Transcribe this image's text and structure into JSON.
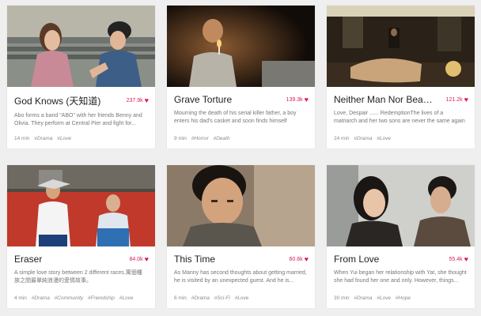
{
  "accent": "#d81b60",
  "cards": [
    {
      "title": "God Knows (天知道)",
      "likes": "237.9k",
      "description": "Abo forms a band \"ABO\" with her friends Benny and Olivia. They perform at Central Pier and fight for...",
      "duration": "14 min",
      "tags": [
        "#Drama",
        "#Love"
      ],
      "heart_icon": "heart-icon"
    },
    {
      "title": "Grave Torture",
      "likes": "139.3k",
      "description": "Mourning the death of his serial killer father, a boy enters his dad's casket and soon finds himself buried...",
      "duration": "9 min",
      "tags": [
        "#Horror",
        "#Death"
      ],
      "heart_icon": "heart-icon"
    },
    {
      "title": "Neither Man Nor Beast (...",
      "likes": "121.2k",
      "description": "Love, Despair ...... RedemptionThe lives of a matriarch and her two sons are never the same again as a...",
      "duration": "24 min",
      "tags": [
        "#Drama",
        "#Love"
      ],
      "heart_icon": "heart-icon"
    },
    {
      "title": "Eraser",
      "likes": "84.0k",
      "description": "A simple love story between 2 different races.寓個種族之間最單純浪漫的愛情故事。",
      "duration": "4 min",
      "tags": [
        "#Drama",
        "#Community",
        "#Friendship",
        "#Love"
      ],
      "heart_icon": "heart-icon"
    },
    {
      "title": "This Time",
      "likes": "60.6k",
      "description": "As Manny has second thoughts about getting married, he is visited by an unexpected guest. And he is...",
      "duration": "6 min",
      "tags": [
        "#Drama",
        "#Sci-Fi",
        "#Love"
      ],
      "heart_icon": "heart-icon"
    },
    {
      "title": "From Love",
      "likes": "55.4k",
      "description": "When Yui began her relationship with Yat, she thought she had found her one and only. However, things...",
      "duration": "30 min",
      "tags": [
        "#Drama",
        "#Love",
        "#Hope"
      ],
      "heart_icon": "heart-icon"
    }
  ]
}
